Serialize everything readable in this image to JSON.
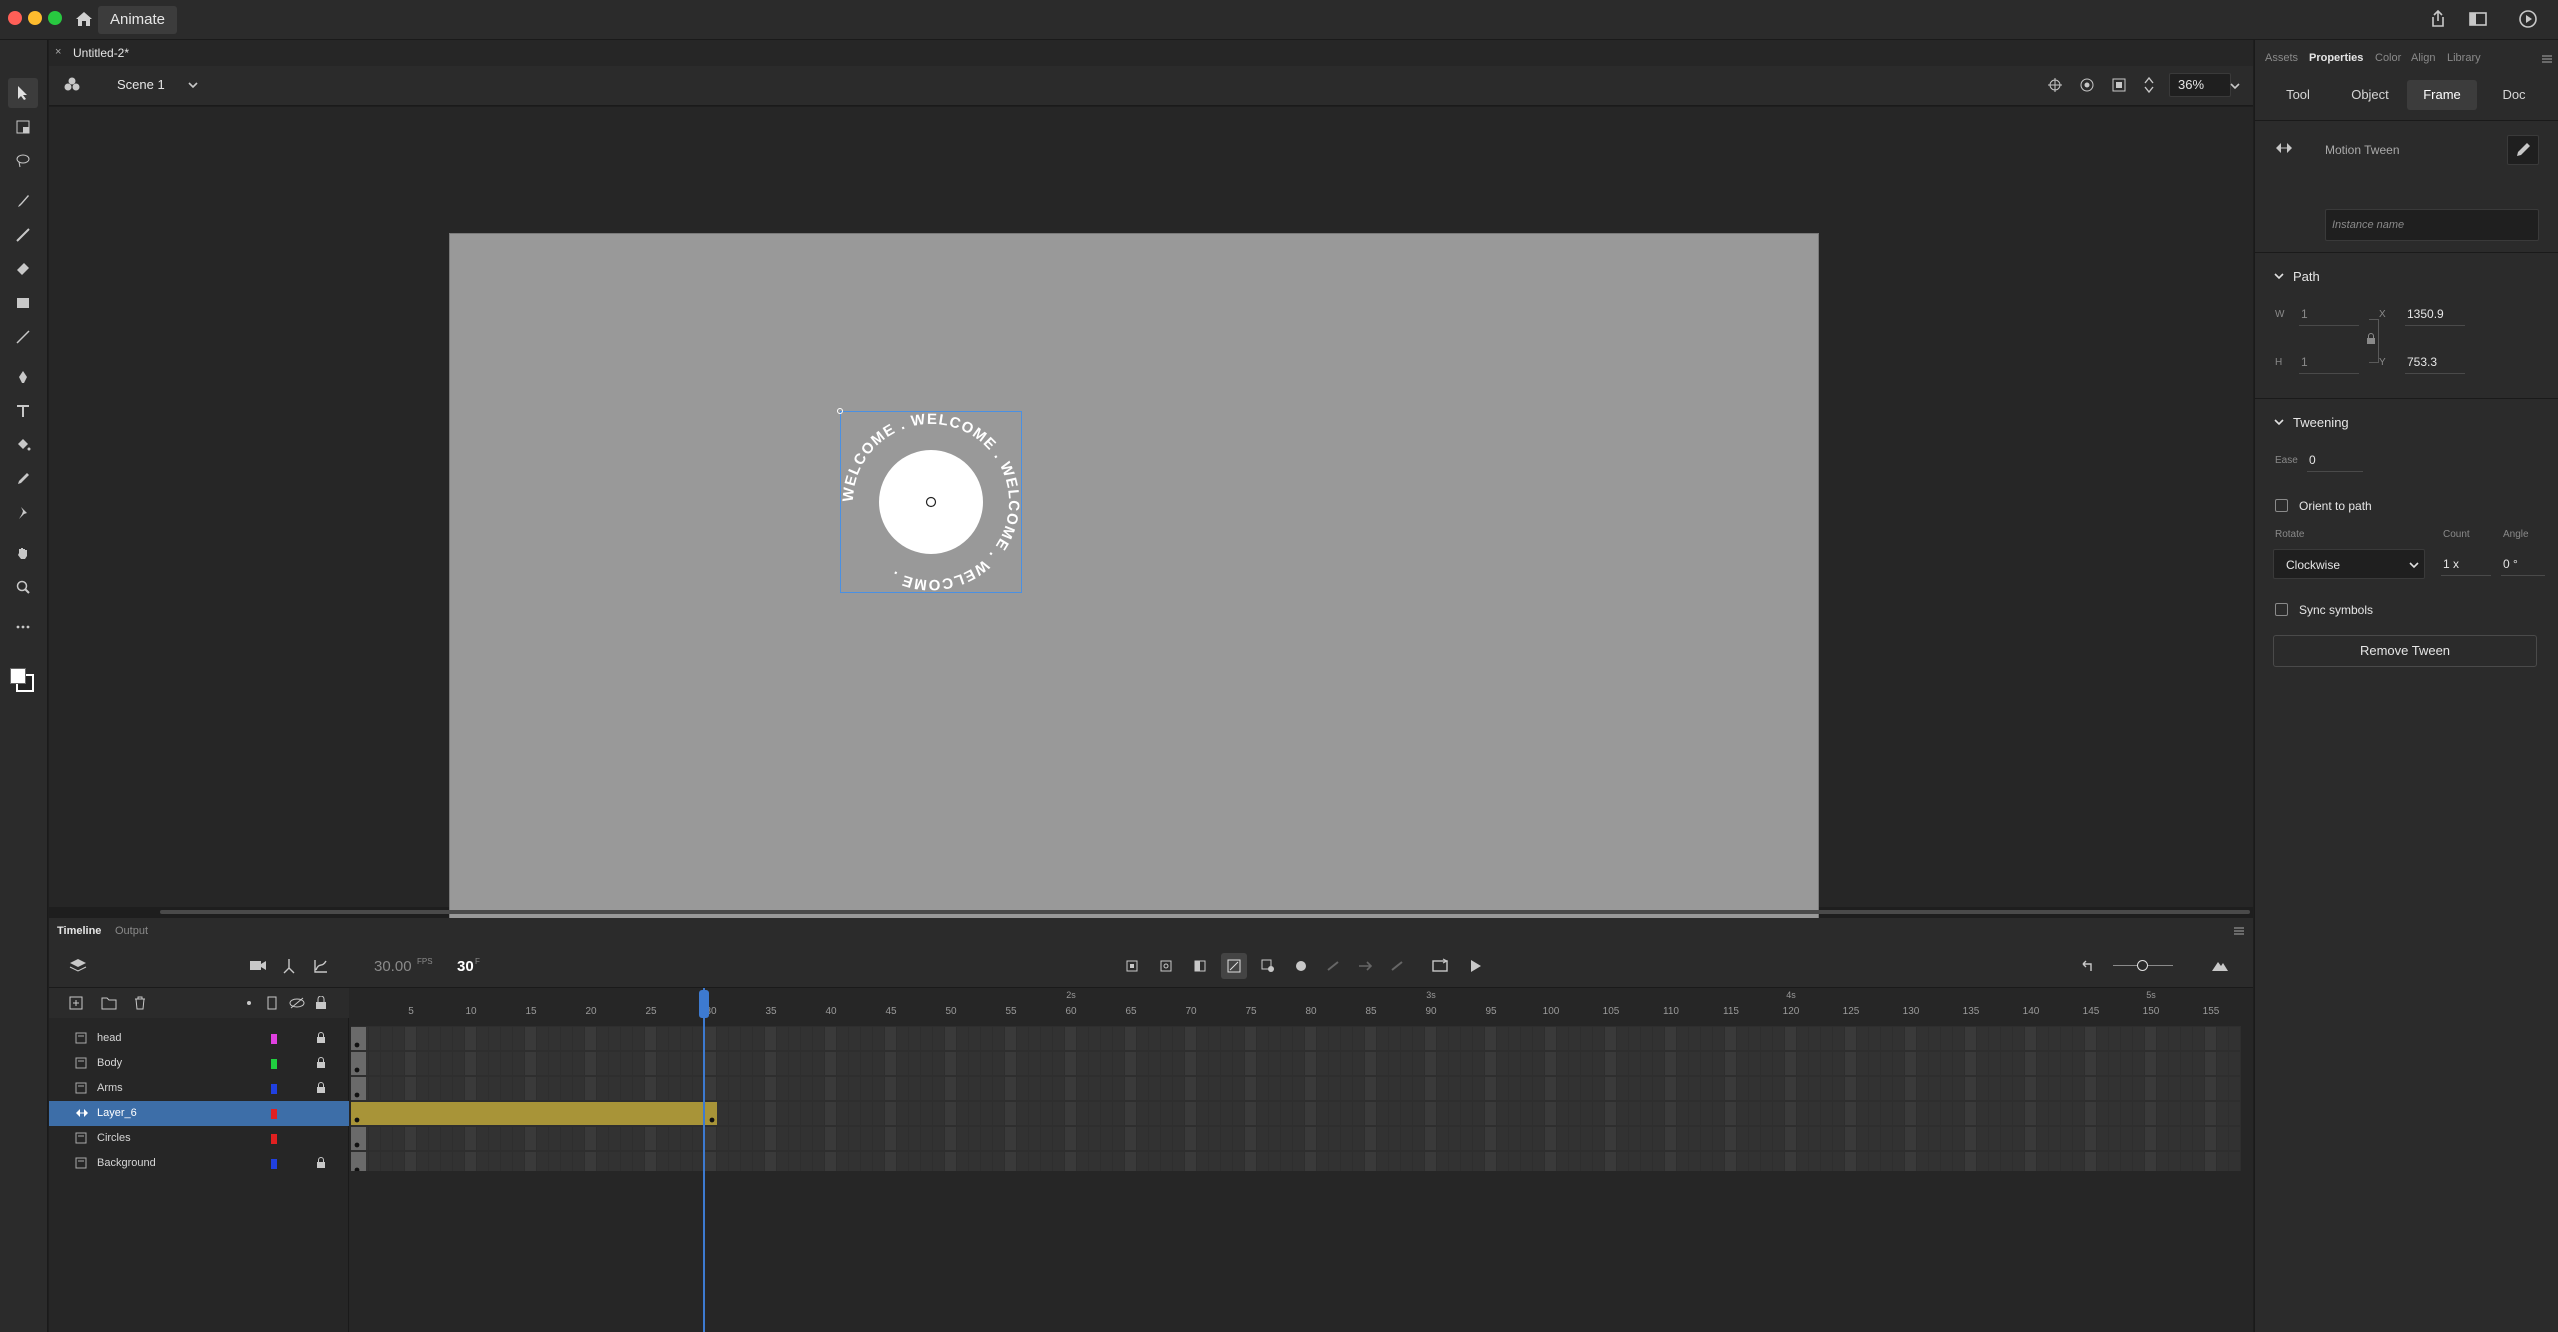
{
  "app": {
    "name": "Animate"
  },
  "document": {
    "tab_title": "Untitled-2*",
    "scene": "Scene 1",
    "zoom": "36%"
  },
  "stage": {
    "symbol_text": "WELCOME . WELCOME . WELCOME . WELCOME ."
  },
  "timeline": {
    "tabs": [
      "Timeline",
      "Output"
    ],
    "fps": "30.00",
    "fps_unit": "FPS",
    "current_frame": "30",
    "frame_unit": "F",
    "ruler_numbers": [
      "5",
      "10",
      "15",
      "20",
      "25",
      "30",
      "35",
      "40",
      "45",
      "50",
      "55",
      "60",
      "65",
      "70",
      "75",
      "80",
      "85",
      "90",
      "95",
      "100",
      "105",
      "110",
      "115",
      "120",
      "125",
      "130",
      "135",
      "140",
      "145",
      "150",
      "155"
    ],
    "ruler_seconds": [
      "2s",
      "3s",
      "4s",
      "5s"
    ],
    "layers": [
      {
        "name": "head",
        "color": "#e040e0",
        "locked": true
      },
      {
        "name": "Body",
        "color": "#20d040",
        "locked": true
      },
      {
        "name": "Arms",
        "color": "#2040e0",
        "locked": true
      },
      {
        "name": "Layer_6",
        "color": "#e02020",
        "locked": false,
        "selected": true
      },
      {
        "name": "Circles",
        "color": "#e02020",
        "locked": false
      },
      {
        "name": "Background",
        "color": "#2040e0",
        "locked": true
      }
    ],
    "tween_color": "#a89438"
  },
  "panel": {
    "tabs": [
      "Assets",
      "Properties",
      "Color",
      "Align",
      "Library"
    ],
    "active_tab": "Properties",
    "subtabs": [
      "Tool",
      "Object",
      "Frame",
      "Doc"
    ],
    "active_subtab": "Frame",
    "tween_type": "Motion Tween",
    "instance_placeholder": "Instance name",
    "path": {
      "title": "Path",
      "w_label": "W",
      "w": "1",
      "h_label": "H",
      "h": "1",
      "x_label": "X",
      "x": "1350.9",
      "y_label": "Y",
      "y": "753.3"
    },
    "tweening": {
      "title": "Tweening",
      "ease_label": "Ease",
      "ease": "0",
      "orient_label": "Orient to path",
      "rotate_label": "Rotate",
      "rotate": "Clockwise",
      "count_label": "Count",
      "count": "1 x",
      "angle_label": "Angle",
      "angle": "0 °",
      "sync_label": "Sync symbols",
      "remove_button": "Remove Tween"
    }
  }
}
